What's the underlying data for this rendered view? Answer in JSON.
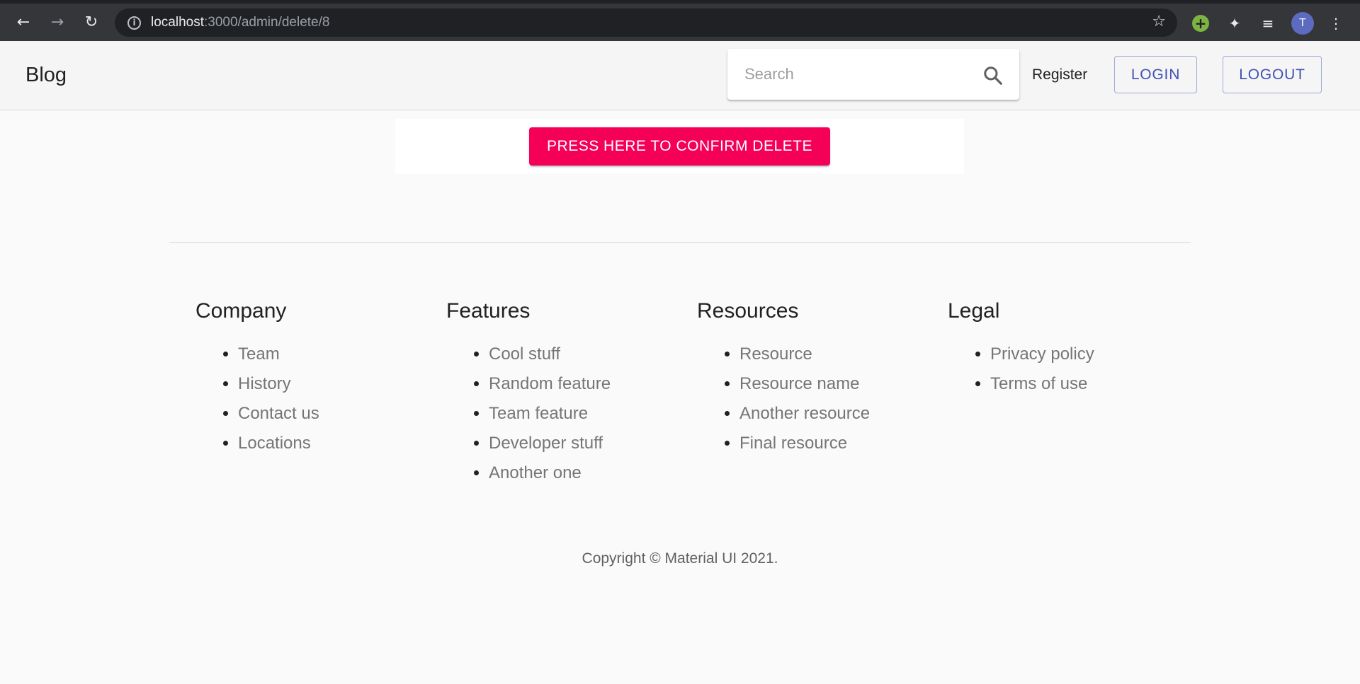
{
  "browser": {
    "url_host": "localhost",
    "url_path": ":3000/admin/delete/8",
    "avatar_letter": "T"
  },
  "appbar": {
    "brand": "Blog",
    "search_placeholder": "Search",
    "register_label": "Register",
    "login_label": "LOGIN",
    "logout_label": "LOGOUT"
  },
  "main": {
    "confirm_label": "PRESS HERE TO CONFIRM DELETE",
    "confirm_color": "#f50057"
  },
  "footer": {
    "columns": [
      {
        "title": "Company",
        "items": [
          "Team",
          "History",
          "Contact us",
          "Locations"
        ]
      },
      {
        "title": "Features",
        "items": [
          "Cool stuff",
          "Random feature",
          "Team feature",
          "Developer stuff",
          "Another one"
        ]
      },
      {
        "title": "Resources",
        "items": [
          "Resource",
          "Resource name",
          "Another resource",
          "Final resource"
        ]
      },
      {
        "title": "Legal",
        "items": [
          "Privacy policy",
          "Terms of use"
        ]
      }
    ],
    "copyright": "Copyright © Material UI 2021."
  },
  "colors": {
    "primary": "#3f51b5",
    "secondary": "#f50057"
  }
}
